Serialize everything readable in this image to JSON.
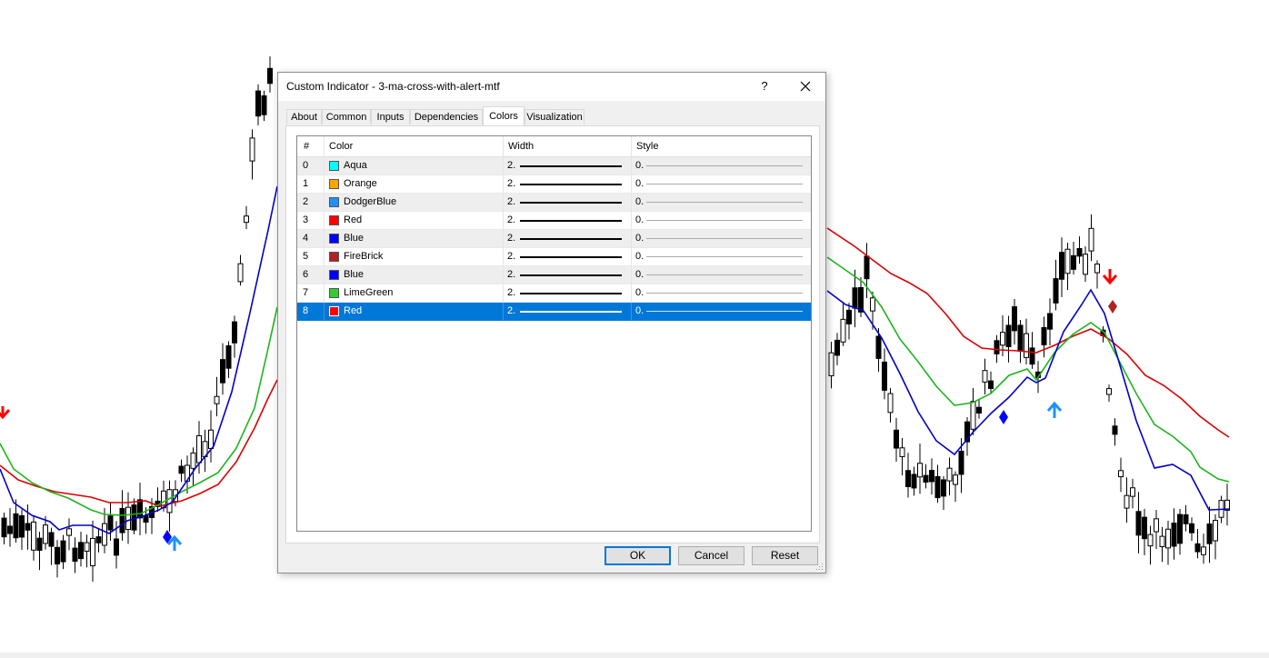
{
  "dialog": {
    "title": "Custom Indicator - 3-ma-cross-with-alert-mtf",
    "help_label": "?",
    "tabs": [
      {
        "label": "About"
      },
      {
        "label": "Common"
      },
      {
        "label": "Inputs"
      },
      {
        "label": "Dependencies"
      },
      {
        "label": "Colors",
        "active": true
      },
      {
        "label": "Visualization"
      }
    ],
    "table": {
      "headers": {
        "index": "#",
        "color": "Color",
        "width": "Width",
        "style": "Style"
      },
      "rows": [
        {
          "index": "0",
          "color_name": "Aqua",
          "swatch": "#00ffff",
          "width": "2.",
          "style": "0."
        },
        {
          "index": "1",
          "color_name": "Orange",
          "swatch": "#ffa500",
          "width": "2.",
          "style": "0."
        },
        {
          "index": "2",
          "color_name": "DodgerBlue",
          "swatch": "#1e90ff",
          "width": "2.",
          "style": "0."
        },
        {
          "index": "3",
          "color_name": "Red",
          "swatch": "#ff0000",
          "width": "2.",
          "style": "0."
        },
        {
          "index": "4",
          "color_name": "Blue",
          "swatch": "#0000ff",
          "width": "2.",
          "style": "0."
        },
        {
          "index": "5",
          "color_name": "FireBrick",
          "swatch": "#b22222",
          "width": "2.",
          "style": "0."
        },
        {
          "index": "6",
          "color_name": "Blue",
          "swatch": "#0000ff",
          "width": "2.",
          "style": "0."
        },
        {
          "index": "7",
          "color_name": "LimeGreen",
          "swatch": "#32cd32",
          "width": "2.",
          "style": "0."
        },
        {
          "index": "8",
          "color_name": "Red",
          "swatch": "#ff0000",
          "width": "2.",
          "style": "0.",
          "selected": true
        }
      ]
    },
    "buttons": {
      "ok": "OK",
      "cancel": "Cancel",
      "reset": "Reset"
    }
  },
  "chart": {
    "ma_colors": {
      "fast": "#0000c8",
      "medium": "#1eb41e",
      "slow": "#dc0000"
    },
    "signal_colors": {
      "buy_arrow": "#1e90ff",
      "sell_arrow": "#ff0000",
      "buy_diamond": "#0000ff",
      "sell_diamond": "#b22222"
    }
  }
}
